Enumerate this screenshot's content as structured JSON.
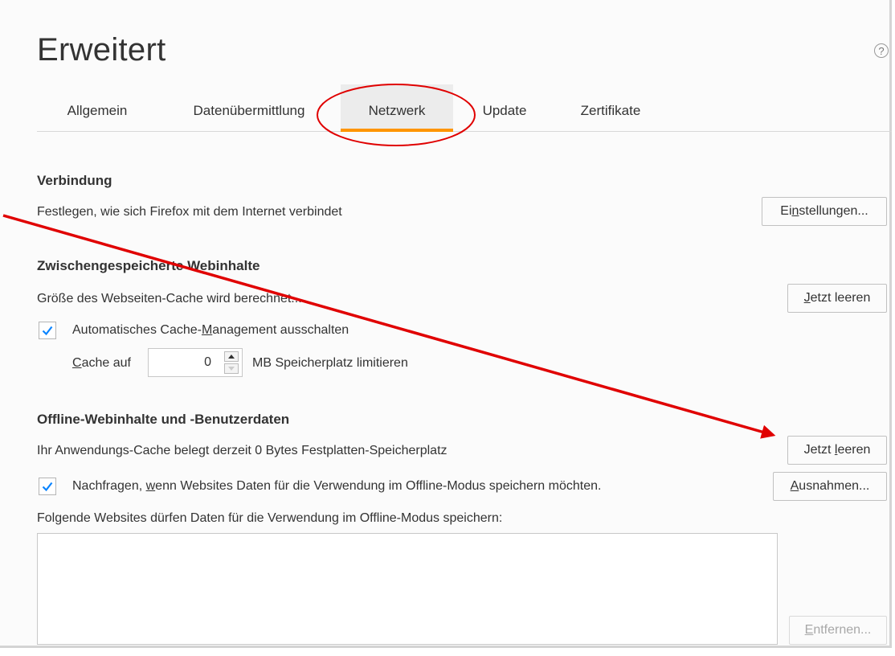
{
  "page": {
    "title": "Erweitert",
    "help_icon": "help-icon"
  },
  "tabs": [
    {
      "label": "Allgemein",
      "selected": false
    },
    {
      "label": "Datenübermittlung",
      "selected": false
    },
    {
      "label": "Netzwerk",
      "selected": true
    },
    {
      "label": "Update",
      "selected": false
    },
    {
      "label": "Zertifikate",
      "selected": false
    }
  ],
  "connection": {
    "heading": "Verbindung",
    "description": "Festlegen, wie sich Firefox mit dem Internet verbindet",
    "settings_button": {
      "pre": "Ei",
      "accel": "n",
      "post": "stellungen..."
    }
  },
  "cache": {
    "heading": "Zwischengespeicherte Webinhalte",
    "status": "Größe des Webseiten-Cache wird berechnet...",
    "clear_button": {
      "pre": "",
      "accel": "J",
      "post": "etzt leeren"
    },
    "override_checkbox": {
      "checked": true,
      "pre": "Automatisches Cache-",
      "accel": "M",
      "post": "anagement ausschalten"
    },
    "limit": {
      "pre": "",
      "accel": "C",
      "post": "ache auf",
      "value": "0",
      "suffix": "MB Speicherplatz limitieren"
    }
  },
  "offline": {
    "heading": "Offline-Webinhalte und -Benutzerdaten",
    "status": "Ihr Anwendungs-Cache belegt derzeit 0 Bytes Festplatten-Speicherplatz",
    "clear_button": {
      "pre": "Jetzt ",
      "accel": "l",
      "post": "eeren"
    },
    "ask_checkbox": {
      "checked": true,
      "pre": "Nachfragen, ",
      "accel": "w",
      "post": "enn Websites Daten für die Verwendung im Offline-Modus speichern möchten."
    },
    "exceptions_button": {
      "pre": "",
      "accel": "A",
      "post": "usnahmen..."
    },
    "list_label": "Folgende Websites dürfen Daten für die Verwendung im Offline-Modus speichern:",
    "remove_button": {
      "pre": "",
      "accel": "E",
      "post": "ntfernen...",
      "disabled": true
    }
  },
  "annotation": {
    "color": "#e00000"
  }
}
